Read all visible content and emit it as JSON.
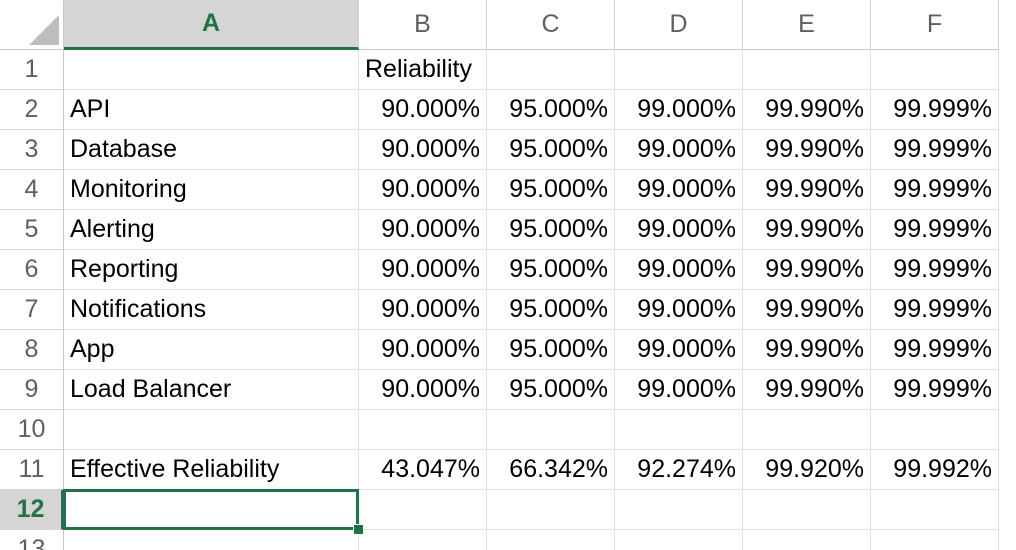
{
  "columns": [
    "A",
    "B",
    "C",
    "D",
    "E",
    "F"
  ],
  "active_column": "A",
  "active_row": "12",
  "rows": [
    {
      "num": "1",
      "a": "",
      "values": [
        "Reliability",
        "",
        "",
        "",
        ""
      ]
    },
    {
      "num": "2",
      "a": "API",
      "values": [
        "90.000%",
        "95.000%",
        "99.000%",
        "99.990%",
        "99.999%"
      ]
    },
    {
      "num": "3",
      "a": "Database",
      "values": [
        "90.000%",
        "95.000%",
        "99.000%",
        "99.990%",
        "99.999%"
      ]
    },
    {
      "num": "4",
      "a": "Monitoring",
      "values": [
        "90.000%",
        "95.000%",
        "99.000%",
        "99.990%",
        "99.999%"
      ]
    },
    {
      "num": "5",
      "a": "Alerting",
      "values": [
        "90.000%",
        "95.000%",
        "99.000%",
        "99.990%",
        "99.999%"
      ]
    },
    {
      "num": "6",
      "a": "Reporting",
      "values": [
        "90.000%",
        "95.000%",
        "99.000%",
        "99.990%",
        "99.999%"
      ]
    },
    {
      "num": "7",
      "a": "Notifications",
      "values": [
        "90.000%",
        "95.000%",
        "99.000%",
        "99.990%",
        "99.999%"
      ]
    },
    {
      "num": "8",
      "a": "App",
      "values": [
        "90.000%",
        "95.000%",
        "99.000%",
        "99.990%",
        "99.999%"
      ]
    },
    {
      "num": "9",
      "a": "Load Balancer",
      "values": [
        "90.000%",
        "95.000%",
        "99.000%",
        "99.990%",
        "99.999%"
      ]
    },
    {
      "num": "10",
      "a": "",
      "values": [
        "",
        "",
        "",
        "",
        ""
      ]
    },
    {
      "num": "11",
      "a": "Effective Reliability",
      "values": [
        "43.047%",
        "66.342%",
        "92.274%",
        "99.920%",
        "99.992%"
      ]
    },
    {
      "num": "12",
      "a": "",
      "values": [
        "",
        "",
        "",
        "",
        ""
      ]
    },
    {
      "num": "13",
      "a": "",
      "values": [
        "",
        "",
        "",
        "",
        ""
      ]
    }
  ]
}
